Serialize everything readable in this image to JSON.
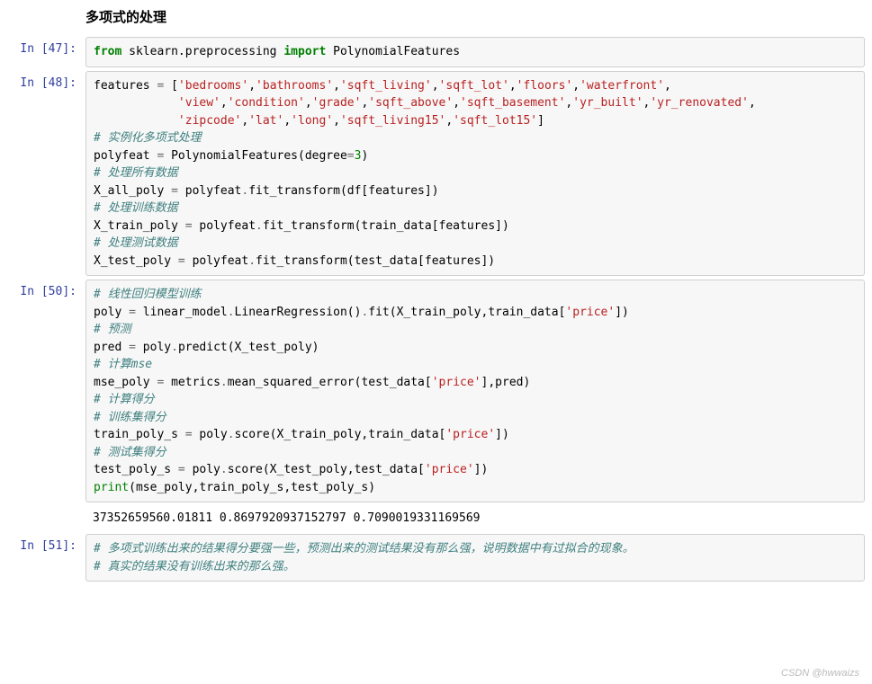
{
  "heading": "多项式的处理",
  "watermark": "CSDN @hwwaizs",
  "cells": [
    {
      "prompt": "In [47]:",
      "type": "code",
      "tokens": [
        {
          "t": "from",
          "c": "kw-green"
        },
        {
          "t": " "
        },
        {
          "t": "sklearn.preprocessing"
        },
        {
          "t": " "
        },
        {
          "t": "import",
          "c": "kw-green"
        },
        {
          "t": " PolynomialFeatures"
        }
      ]
    },
    {
      "prompt": "In [48]:",
      "type": "code",
      "tokens": [
        {
          "t": "features "
        },
        {
          "t": "=",
          "c": "op"
        },
        {
          "t": " ["
        },
        {
          "t": "'bedrooms'",
          "c": "str"
        },
        {
          "t": ","
        },
        {
          "t": "'bathrooms'",
          "c": "str"
        },
        {
          "t": ","
        },
        {
          "t": "'sqft_living'",
          "c": "str"
        },
        {
          "t": ","
        },
        {
          "t": "'sqft_lot'",
          "c": "str"
        },
        {
          "t": ","
        },
        {
          "t": "'floors'",
          "c": "str"
        },
        {
          "t": ","
        },
        {
          "t": "'waterfront'",
          "c": "str"
        },
        {
          "t": ",\n            "
        },
        {
          "t": "'view'",
          "c": "str"
        },
        {
          "t": ","
        },
        {
          "t": "'condition'",
          "c": "str"
        },
        {
          "t": ","
        },
        {
          "t": "'grade'",
          "c": "str"
        },
        {
          "t": ","
        },
        {
          "t": "'sqft_above'",
          "c": "str"
        },
        {
          "t": ","
        },
        {
          "t": "'sqft_basement'",
          "c": "str"
        },
        {
          "t": ","
        },
        {
          "t": "'yr_built'",
          "c": "str"
        },
        {
          "t": ","
        },
        {
          "t": "'yr_renovated'",
          "c": "str"
        },
        {
          "t": ",\n            "
        },
        {
          "t": "'zipcode'",
          "c": "str"
        },
        {
          "t": ","
        },
        {
          "t": "'lat'",
          "c": "str"
        },
        {
          "t": ","
        },
        {
          "t": "'long'",
          "c": "str"
        },
        {
          "t": ","
        },
        {
          "t": "'sqft_living15'",
          "c": "str"
        },
        {
          "t": ","
        },
        {
          "t": "'sqft_lot15'",
          "c": "str"
        },
        {
          "t": "]\n"
        },
        {
          "t": "# 实例化多项式处理",
          "c": "cmt"
        },
        {
          "t": "\n"
        },
        {
          "t": "polyfeat "
        },
        {
          "t": "=",
          "c": "op"
        },
        {
          "t": " PolynomialFeatures(degree"
        },
        {
          "t": "=",
          "c": "op"
        },
        {
          "t": "3",
          "c": "num"
        },
        {
          "t": ")\n"
        },
        {
          "t": "# 处理所有数据",
          "c": "cmt"
        },
        {
          "t": "\n"
        },
        {
          "t": "X_all_poly "
        },
        {
          "t": "=",
          "c": "op"
        },
        {
          "t": " polyfeat"
        },
        {
          "t": ".",
          "c": "op"
        },
        {
          "t": "fit_transform(df[features])\n"
        },
        {
          "t": "# 处理训练数据",
          "c": "cmt"
        },
        {
          "t": "\n"
        },
        {
          "t": "X_train_poly "
        },
        {
          "t": "=",
          "c": "op"
        },
        {
          "t": " polyfeat"
        },
        {
          "t": ".",
          "c": "op"
        },
        {
          "t": "fit_transform(train_data[features])\n"
        },
        {
          "t": "# 处理测试数据",
          "c": "cmt"
        },
        {
          "t": "\n"
        },
        {
          "t": "X_test_poly "
        },
        {
          "t": "=",
          "c": "op"
        },
        {
          "t": " polyfeat"
        },
        {
          "t": ".",
          "c": "op"
        },
        {
          "t": "fit_transform(test_data[features])"
        }
      ]
    },
    {
      "prompt": "In [50]:",
      "type": "code",
      "tokens": [
        {
          "t": "# 线性回归模型训练",
          "c": "cmt"
        },
        {
          "t": "\n"
        },
        {
          "t": "poly "
        },
        {
          "t": "=",
          "c": "op"
        },
        {
          "t": " linear_model"
        },
        {
          "t": ".",
          "c": "op"
        },
        {
          "t": "LinearRegression()"
        },
        {
          "t": ".",
          "c": "op"
        },
        {
          "t": "fit(X_train_poly,train_data["
        },
        {
          "t": "'price'",
          "c": "str"
        },
        {
          "t": "])\n"
        },
        {
          "t": "# 预测",
          "c": "cmt"
        },
        {
          "t": "\n"
        },
        {
          "t": "pred "
        },
        {
          "t": "=",
          "c": "op"
        },
        {
          "t": " poly"
        },
        {
          "t": ".",
          "c": "op"
        },
        {
          "t": "predict(X_test_poly)\n"
        },
        {
          "t": "# 计算mse",
          "c": "cmt"
        },
        {
          "t": "\n"
        },
        {
          "t": "mse_poly "
        },
        {
          "t": "=",
          "c": "op"
        },
        {
          "t": " metrics"
        },
        {
          "t": ".",
          "c": "op"
        },
        {
          "t": "mean_squared_error(test_data["
        },
        {
          "t": "'price'",
          "c": "str"
        },
        {
          "t": "],pred)\n"
        },
        {
          "t": "# 计算得分",
          "c": "cmt"
        },
        {
          "t": "\n"
        },
        {
          "t": "# 训练集得分",
          "c": "cmt"
        },
        {
          "t": "\n"
        },
        {
          "t": "train_poly_s "
        },
        {
          "t": "=",
          "c": "op"
        },
        {
          "t": " poly"
        },
        {
          "t": ".",
          "c": "op"
        },
        {
          "t": "score(X_train_poly,train_data["
        },
        {
          "t": "'price'",
          "c": "str"
        },
        {
          "t": "])\n"
        },
        {
          "t": "# 测试集得分",
          "c": "cmt"
        },
        {
          "t": "\n"
        },
        {
          "t": "test_poly_s "
        },
        {
          "t": "=",
          "c": "op"
        },
        {
          "t": " poly"
        },
        {
          "t": ".",
          "c": "op"
        },
        {
          "t": "score(X_test_poly,test_data["
        },
        {
          "t": "'price'",
          "c": "str"
        },
        {
          "t": "])\n"
        },
        {
          "t": "print",
          "c": "builtin"
        },
        {
          "t": "(mse_poly,train_poly_s,test_poly_s)"
        }
      ],
      "output": "37352659560.01811 0.8697920937152797 0.7090019331169569"
    },
    {
      "prompt": "In [51]:",
      "type": "code",
      "tokens": [
        {
          "t": "# 多项式训练出来的结果得分要强一些，预测出来的测试结果没有那么强，说明数据中有过拟合的现象。",
          "c": "cmt"
        },
        {
          "t": "\n"
        },
        {
          "t": "# 真实的结果没有训练出来的那么强。",
          "c": "cmt"
        }
      ]
    }
  ]
}
